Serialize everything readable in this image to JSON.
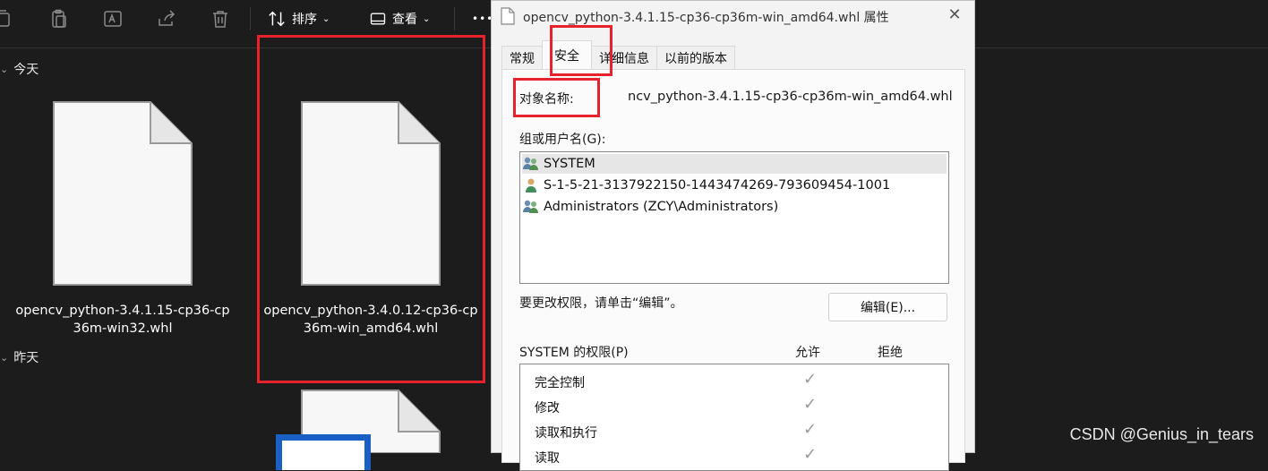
{
  "toolbar": {
    "sort_label": "排序",
    "view_label": "查看",
    "more_label": "•••"
  },
  "groups": {
    "today": "今天",
    "yesterday": "昨天"
  },
  "files": [
    {
      "name_line1": "opencv_python-3.4.1.15-cp36-cp",
      "name_line2": "36m-win32.whl"
    },
    {
      "name_line1": "opencv_python-3.4.0.12-cp36-cp",
      "name_line2": "36m-win_amd64.whl"
    }
  ],
  "dialog": {
    "title": "opencv_python-3.4.1.15-cp36-cp36m-win_amd64.whl 属性",
    "tabs": [
      "常规",
      "安全",
      "详细信息",
      "以前的版本"
    ],
    "active_tab": "安全",
    "object_name_label": "对象名称:",
    "object_name_value": "ncv_python-3.4.1.15-cp36-cp36m-win_amd64.whl",
    "group_label": "组或用户名(G):",
    "users": [
      {
        "name": "SYSTEM",
        "icon": "user-group-icon"
      },
      {
        "name": "S-1-5-21-3137922150-1443474269-793609454-1001",
        "icon": "user-icon"
      },
      {
        "name": "Administrators (ZCY\\Administrators)",
        "icon": "user-group-icon"
      }
    ],
    "change_hint": "要更改权限，请单击“编辑”。",
    "edit_button": "编辑(E)...",
    "perm_header": "SYSTEM 的权限(P)",
    "allow_header": "允许",
    "deny_header": "拒绝",
    "permissions": [
      "完全控制",
      "修改",
      "读取和执行",
      "读取"
    ],
    "check_glyph": "✓"
  },
  "watermark": "CSDN @Genius_in_tears",
  "colors": {
    "highlight_red": "#e8222d",
    "selection_blue": "#1a5fc4"
  }
}
